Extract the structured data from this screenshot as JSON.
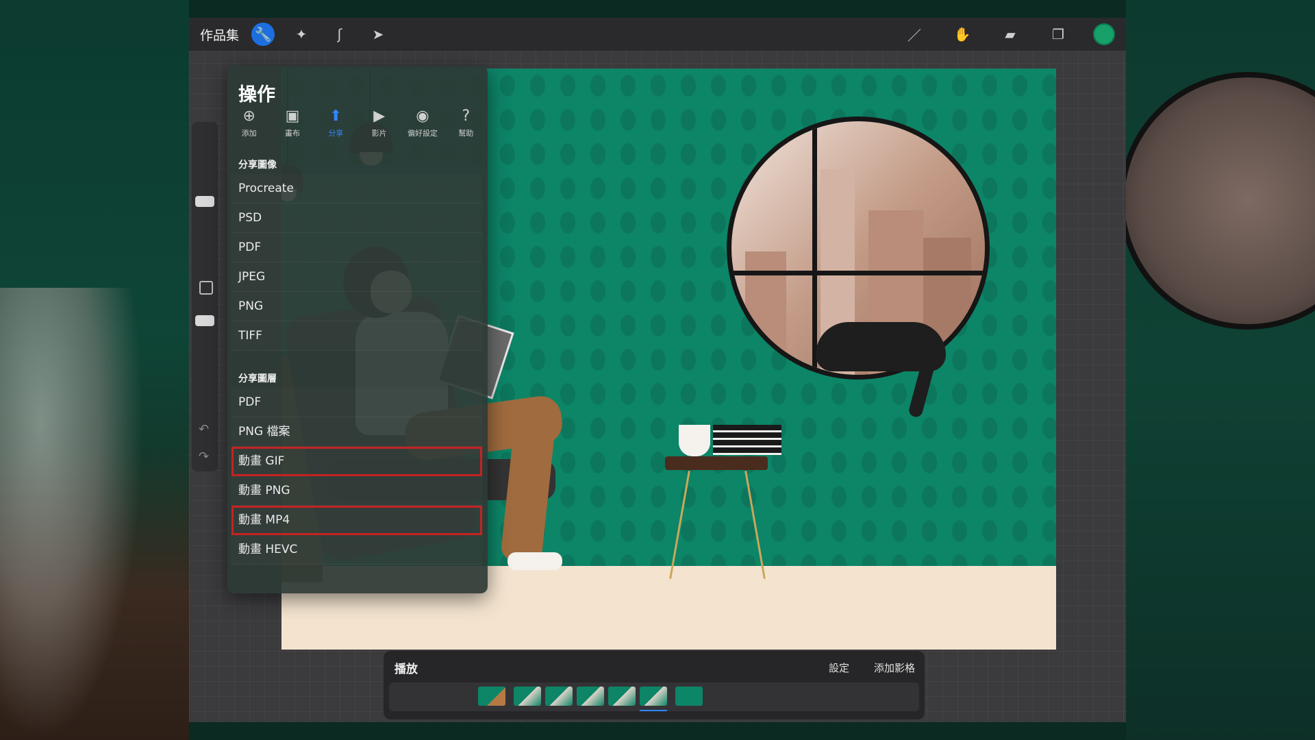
{
  "app": {
    "gallery_label": "作品集",
    "accent_color": "#1d6fe0",
    "current_color": "#17a06a"
  },
  "toolbar_left": {
    "items": [
      {
        "name": "wrench-icon",
        "glyph": "🔧"
      },
      {
        "name": "magic-wand-icon",
        "glyph": "✦"
      },
      {
        "name": "selection-icon",
        "glyph": "ʃ"
      },
      {
        "name": "transform-arrow-icon",
        "glyph": "➤"
      }
    ]
  },
  "toolbar_right": {
    "items": [
      {
        "name": "brush-icon",
        "glyph": "／"
      },
      {
        "name": "smudge-icon",
        "glyph": "✋"
      },
      {
        "name": "eraser-icon",
        "glyph": "▰"
      },
      {
        "name": "layers-icon",
        "glyph": "❐"
      }
    ]
  },
  "actions": {
    "title": "操作",
    "tabs": [
      {
        "icon": "⊕",
        "label": "添加"
      },
      {
        "icon": "▣",
        "label": "畫布"
      },
      {
        "icon": "⬆",
        "label": "分享"
      },
      {
        "icon": "▶",
        "label": "影片"
      },
      {
        "icon": "◉",
        "label": "偏好設定"
      },
      {
        "icon": "?",
        "label": "幫助"
      }
    ],
    "share_image_title": "分享圖像",
    "share_image_items": [
      "Procreate",
      "PSD",
      "PDF",
      "JPEG",
      "PNG",
      "TIFF"
    ],
    "share_layers_title": "分享圖層",
    "share_layers_items": [
      "PDF",
      "PNG 檔案",
      "動畫 GIF",
      "動畫 PNG",
      "動畫 MP4",
      "動畫 HEVC"
    ]
  },
  "timeline": {
    "play_label": "播放",
    "settings_label": "設定",
    "add_frame_label": "添加影格"
  },
  "sidebar": {
    "undo_glyph": "↶",
    "redo_glyph": "↷"
  }
}
